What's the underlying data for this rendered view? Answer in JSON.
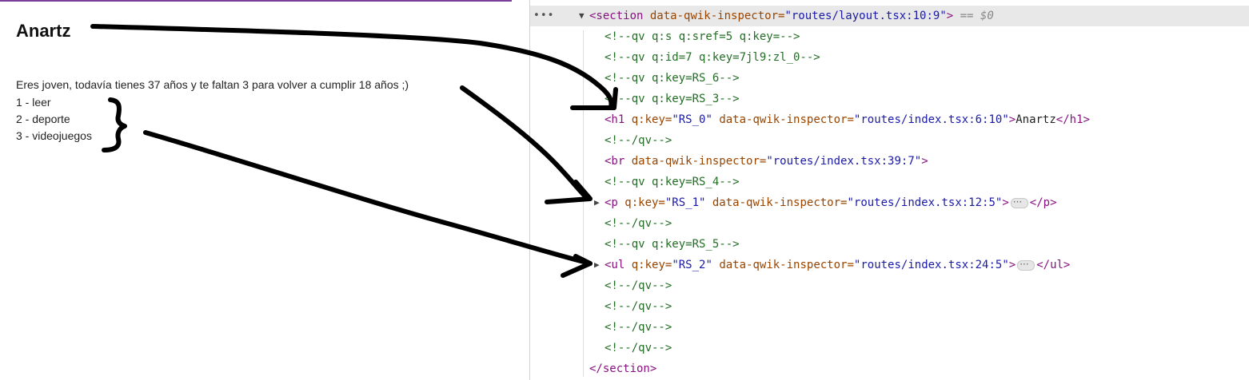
{
  "page": {
    "heading": "Anartz",
    "paragraph": "Eres joven, todavía tienes 37 años y te faltan 3 para volver a cumplir 18 años ;)",
    "list": [
      "1 - leer",
      "2 - deporte",
      "3 - videojuegos"
    ]
  },
  "devtools": {
    "lines": [
      {
        "indent": 0,
        "kind": "section-open",
        "tag_open": "<section",
        "attr": " data-qwik-inspector=",
        "val": "\"routes/layout.tsx:10:9\"",
        "tag_close": ">",
        "ref": " == $0"
      },
      {
        "indent": 1,
        "kind": "comment",
        "text": "<!--qv q:s q:sref=5 q:key=-->"
      },
      {
        "indent": 1,
        "kind": "comment",
        "text": "<!--qv q:id=7 q:key=7jl9:zl_0-->"
      },
      {
        "indent": 1,
        "kind": "comment",
        "text": "<!--qv q:key=RS_6-->"
      },
      {
        "indent": 1,
        "kind": "comment",
        "text": "<!--qv q:key=RS_3-->"
      },
      {
        "indent": 1,
        "kind": "element",
        "tag_open": "<h1",
        "attr1": " q:key=",
        "val1": "\"RS_0\"",
        "attr2": " data-qwik-inspector=",
        "val2": "\"routes/index.tsx:6:10\"",
        "tag_close": ">",
        "text": "Anartz",
        "end_tag": "</h1>"
      },
      {
        "indent": 1,
        "kind": "comment",
        "text": "<!--/qv-->"
      },
      {
        "indent": 1,
        "kind": "element-br",
        "tag_open": "<br",
        "attr": " data-qwik-inspector=",
        "val": "\"routes/index.tsx:39:7\"",
        "tag_close": ">"
      },
      {
        "indent": 1,
        "kind": "comment",
        "text": "<!--qv q:key=RS_4-->"
      },
      {
        "indent": 1,
        "kind": "collapsed",
        "tag_open": "<p",
        "attr1": " q:key=",
        "val1": "\"RS_1\"",
        "attr2": " data-qwik-inspector=",
        "val2": "\"routes/index.tsx:12:5\"",
        "tag_close": ">",
        "end_tag": "</p>"
      },
      {
        "indent": 1,
        "kind": "comment",
        "text": "<!--/qv-->"
      },
      {
        "indent": 1,
        "kind": "comment",
        "text": "<!--qv q:key=RS_5-->"
      },
      {
        "indent": 1,
        "kind": "collapsed",
        "tag_open": "<ul",
        "attr1": " q:key=",
        "val1": "\"RS_2\"",
        "attr2": " data-qwik-inspector=",
        "val2": "\"routes/index.tsx:24:5\"",
        "tag_close": ">",
        "end_tag": "</ul>"
      },
      {
        "indent": 1,
        "kind": "comment",
        "text": "<!--/qv-->"
      },
      {
        "indent": 1,
        "kind": "comment",
        "text": "<!--/qv-->"
      },
      {
        "indent": 1,
        "kind": "comment",
        "text": "<!--/qv-->"
      },
      {
        "indent": 1,
        "kind": "comment",
        "text": "<!--/qv-->"
      },
      {
        "indent": 0,
        "kind": "close",
        "text": "</section>"
      }
    ]
  },
  "colors": {
    "tag": "#881280",
    "attribute": "#994500",
    "value": "#1a1aa6",
    "comment": "#236e25",
    "selected_row": "#e8e8e8"
  }
}
